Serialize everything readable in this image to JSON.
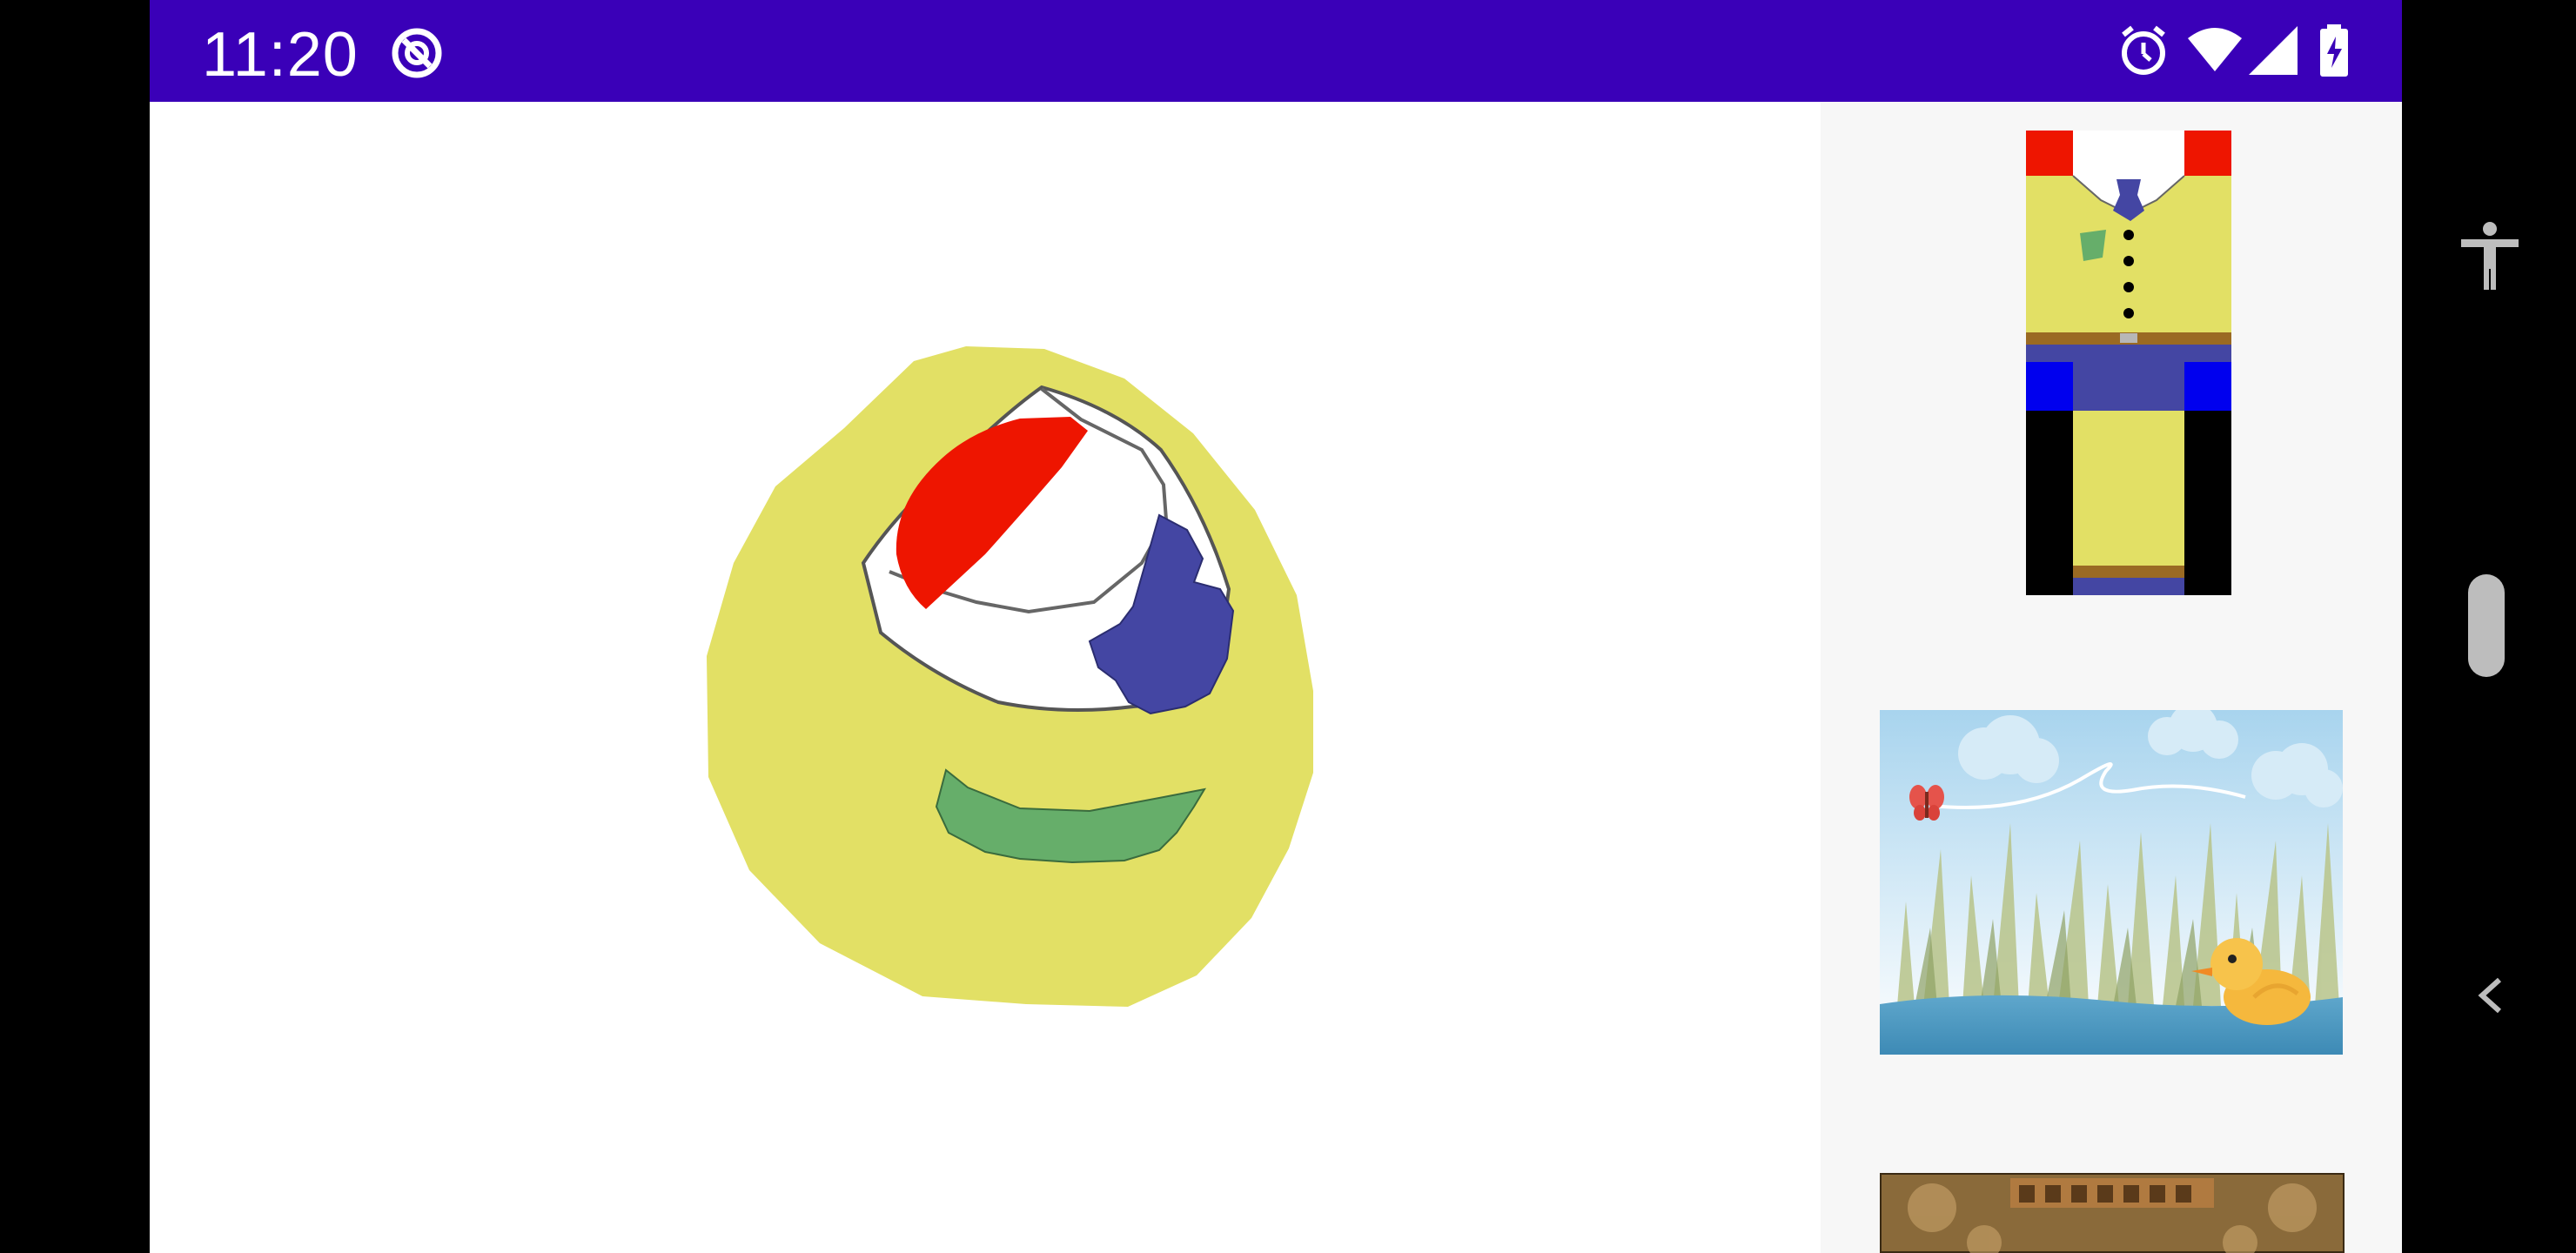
{
  "status_bar": {
    "time": "11:20",
    "icons": [
      "do-not-disturb-icon",
      "alarm-icon",
      "wifi-icon",
      "signal-icon",
      "battery-charging-icon"
    ],
    "background": "#3a00b8"
  },
  "viewer": {
    "object": "3d-textured-sphere",
    "texture_colors": {
      "body": "#e2e065",
      "collar": "#ffffff",
      "shoulders": "#ee1500",
      "tie": "#4446a3",
      "pocket": "#66ae6a",
      "buttons": "#000000"
    }
  },
  "side_panel": {
    "background": "#f7f7f7",
    "thumbnails": [
      {
        "name": "shirt-texture-thumbnail",
        "description": "shirt-texture"
      },
      {
        "name": "duck-pond-texture-thumbnail",
        "description": "duck-pond-texture"
      },
      {
        "name": "ornate-texture-thumbnail",
        "description": "ornate-texture"
      }
    ]
  },
  "nav_bar": {
    "icons": [
      "accessibility-icon",
      "scroll-handle",
      "back-icon"
    ]
  }
}
